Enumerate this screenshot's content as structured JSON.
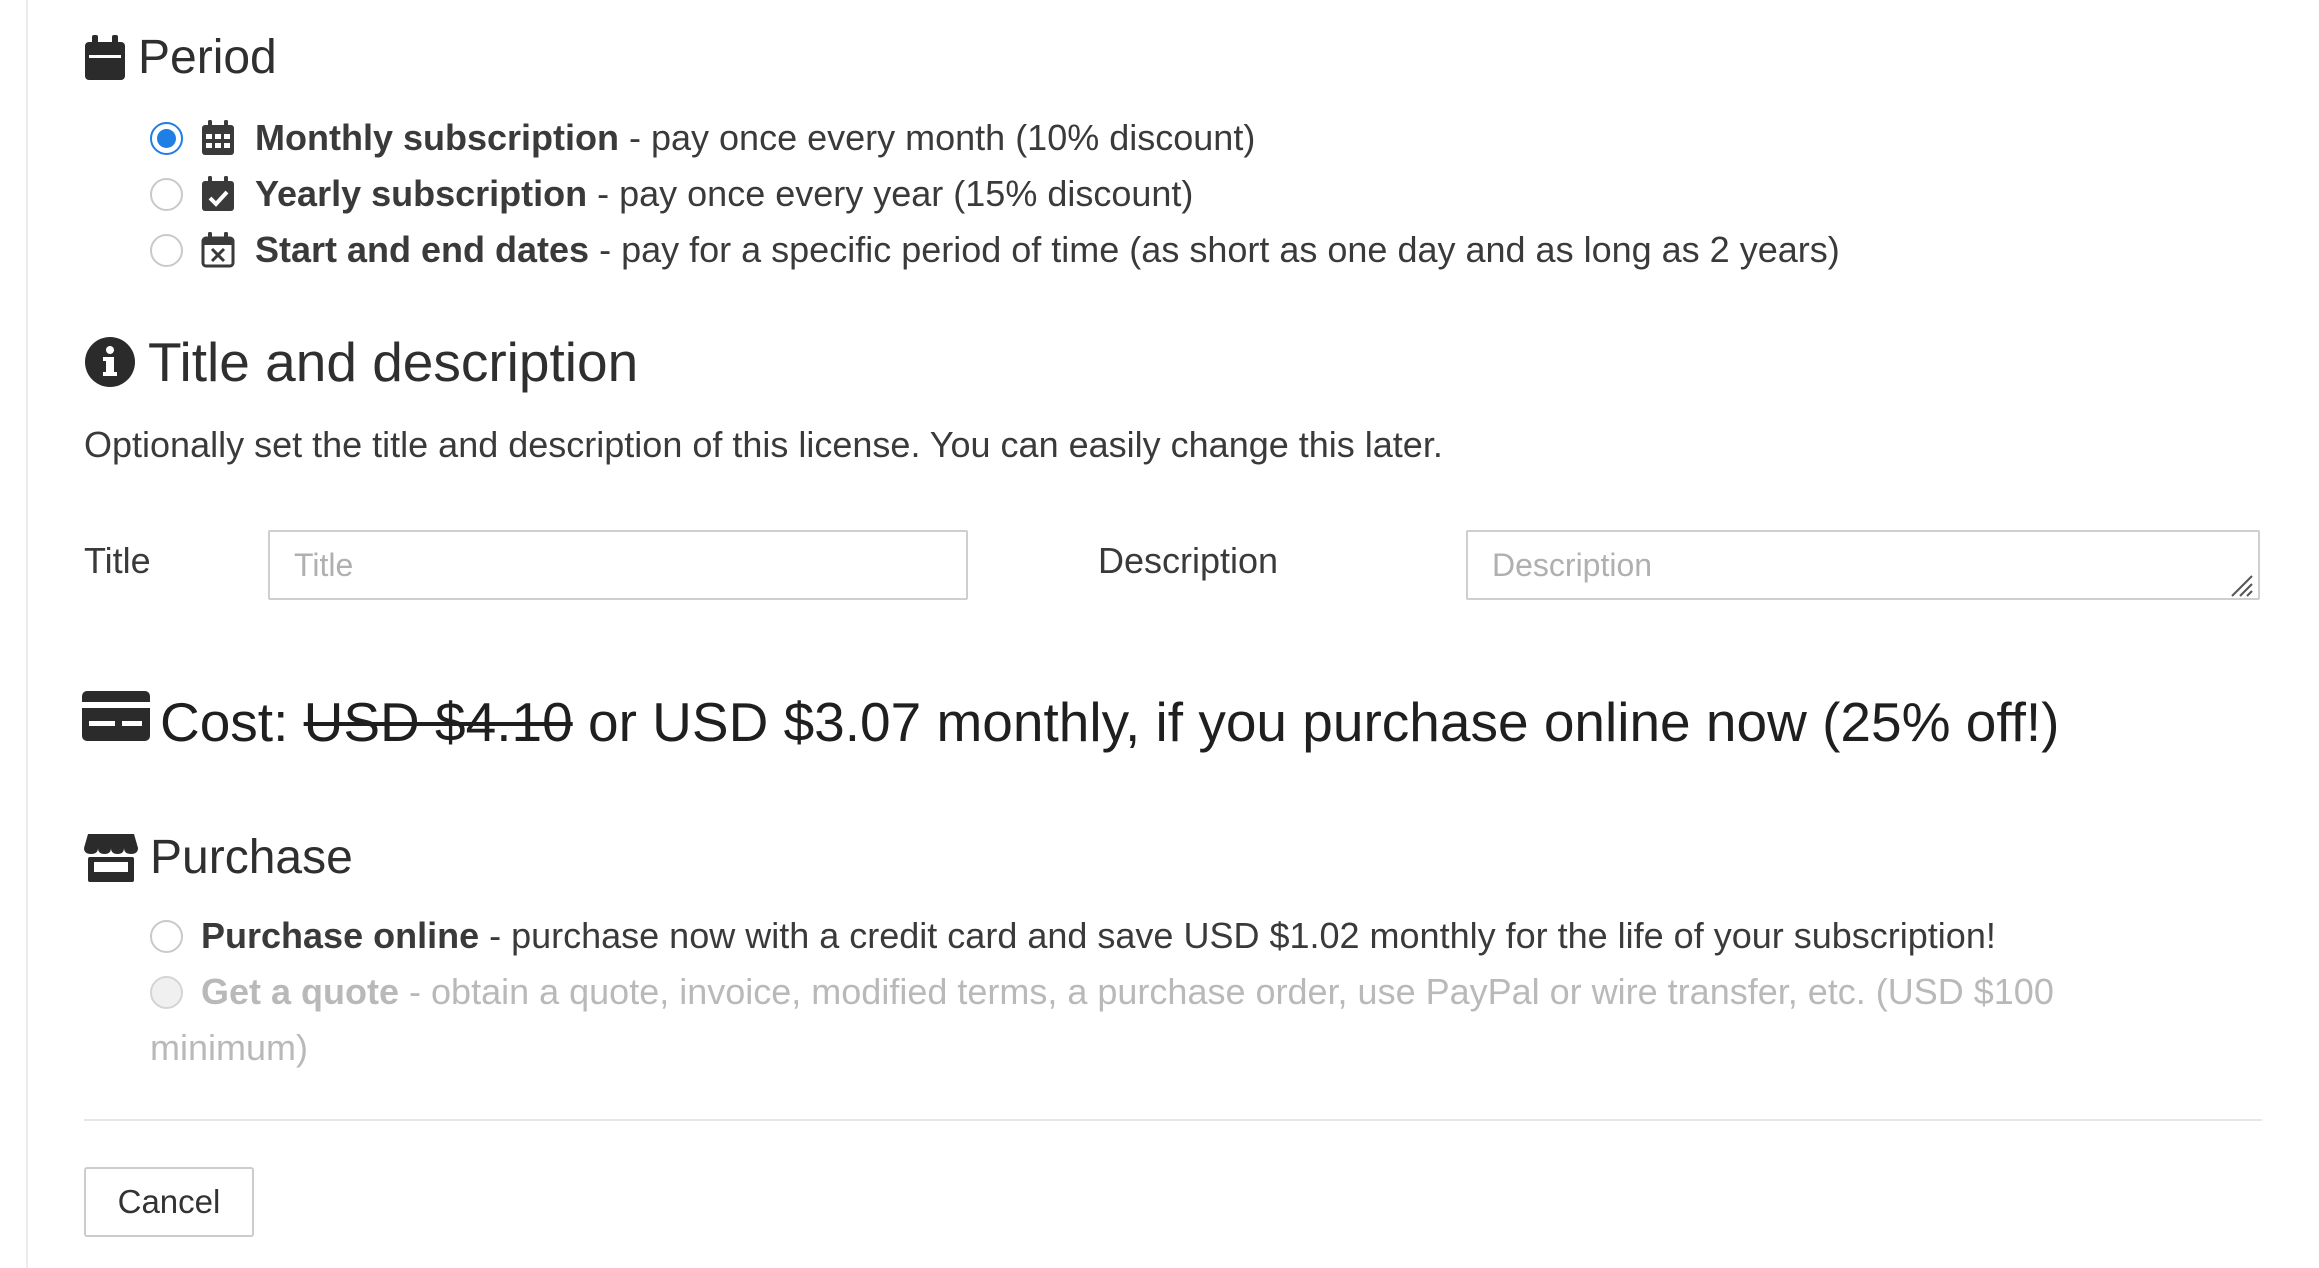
{
  "period": {
    "heading": "Period",
    "heading_icon": "calendar-icon",
    "options": [
      {
        "label": "Monthly subscription",
        "description": " - pay once every month (10% discount)",
        "icon": "calendar-days-icon",
        "selected": true
      },
      {
        "label": "Yearly subscription",
        "description": " - pay once every year (15% discount)",
        "icon": "calendar-check-icon",
        "selected": false
      },
      {
        "label": "Start and end dates",
        "description": " - pay for a specific period of time (as short as one day and as long as 2 years)",
        "icon": "calendar-times-icon",
        "selected": false
      }
    ]
  },
  "title_description": {
    "heading": "Title and description",
    "heading_icon": "info-circle-icon",
    "help_text": "Optionally set the title and description of this license. You can easily change this later.",
    "title_label": "Title",
    "title_value": "",
    "title_placeholder": "Title",
    "description_label": "Description",
    "description_value": "",
    "description_placeholder": "Description"
  },
  "cost": {
    "prefix": "Cost: ",
    "original_price": "USD $4.10",
    "rest": " or USD $3.07 monthly, if you purchase online now (25% off!)",
    "icon": "credit-card-icon"
  },
  "purchase": {
    "heading": "Purchase",
    "heading_icon": "store-icon",
    "options": [
      {
        "label": "Purchase online",
        "description": " - purchase now with a credit card and save USD $1.02 monthly for the life of your subscription!",
        "enabled": true,
        "selected": false
      },
      {
        "label": "Get a quote",
        "description": " - obtain a quote, invoice, modified terms, a purchase order, use PayPal or wire transfer, etc. (USD $100",
        "description_continued": "minimum)",
        "enabled": false,
        "selected": false
      }
    ]
  },
  "actions": {
    "cancel_label": "Cancel"
  },
  "colors": {
    "accent": "#1f7fe5",
    "text": "#333333",
    "disabled_text": "#b9b9b9",
    "border": "#cfcfcf"
  }
}
